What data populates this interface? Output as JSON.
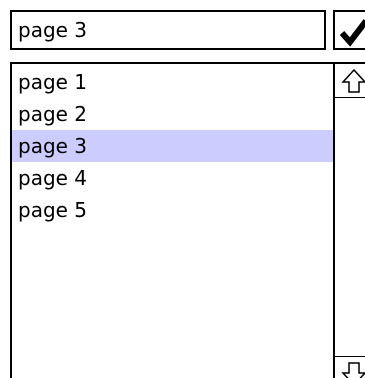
{
  "combo": {
    "input_value": "page 3",
    "confirm_icon": "checkmark-icon"
  },
  "list": {
    "items": [
      {
        "label": "page 1"
      },
      {
        "label": "page 2"
      },
      {
        "label": "page 3"
      },
      {
        "label": "page 4"
      },
      {
        "label": "page 5"
      }
    ],
    "selected_index": 2,
    "selected_color": "#ccccff"
  },
  "scrollbar": {
    "up_icon": "arrow-up-icon",
    "down_icon": "arrow-down-icon"
  }
}
